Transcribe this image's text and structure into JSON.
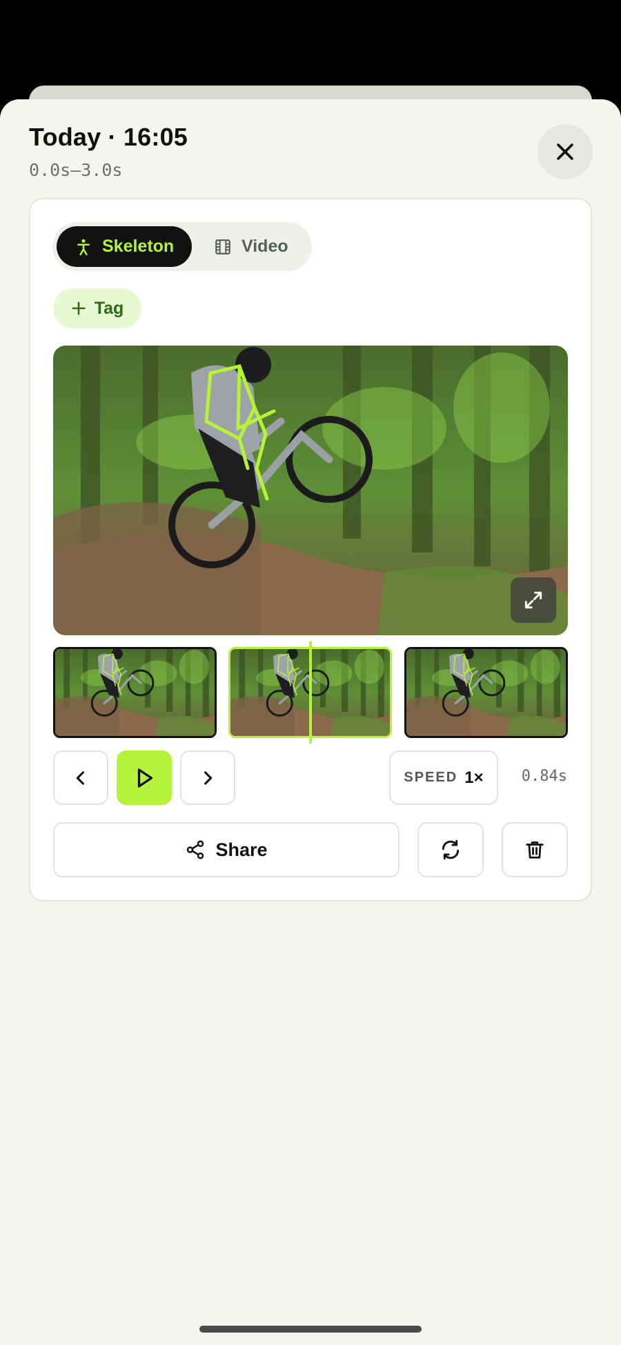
{
  "header": {
    "title": "Today · 16:05",
    "range": "0.0s–3.0s"
  },
  "view_toggle": {
    "options": [
      {
        "label": "Skeleton",
        "icon": "person-icon",
        "selected": true
      },
      {
        "label": "Video",
        "icon": "film-icon",
        "selected": false
      }
    ]
  },
  "tag_button": {
    "label": "Tag",
    "icon": "plus-icon"
  },
  "media": {
    "frames": [
      {
        "selected": false
      },
      {
        "selected": true
      },
      {
        "selected": false
      }
    ],
    "expand_icon": "expand-icon"
  },
  "playback": {
    "speed_label": "SPEED",
    "speed_value": "1×",
    "current_time": "0.84s"
  },
  "actions": {
    "share_label": "Share",
    "share_icon": "share-icon",
    "refresh_icon": "refresh-icon",
    "delete_icon": "trash-icon"
  },
  "colors": {
    "accent": "#b6f23a",
    "dark": "#111312",
    "tag_bg": "#e8f8d2",
    "tag_text": "#2f6a17",
    "sheet_bg": "#f3f6ef"
  }
}
